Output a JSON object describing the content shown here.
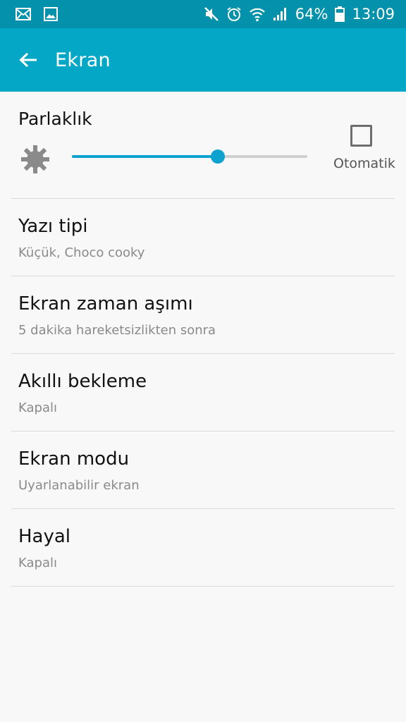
{
  "status_bar": {
    "battery": "64%",
    "time": "13:09",
    "icons": [
      "email-icon",
      "image-icon",
      "mute-icon",
      "alarm-icon",
      "wifi-icon",
      "signal-icon",
      "battery-icon"
    ]
  },
  "app_bar": {
    "title": "Ekran"
  },
  "brightness": {
    "title": "Parlaklık",
    "level_percent": 62,
    "auto_label": "Otomatik",
    "auto_checked": false
  },
  "settings": [
    {
      "title": "Yazı tipi",
      "subtitle": "Küçük, Choco cooky"
    },
    {
      "title": "Ekran zaman aşımı",
      "subtitle": "5 dakika hareketsizlikten sonra"
    },
    {
      "title": "Akıllı bekleme",
      "subtitle": "Kapalı"
    },
    {
      "title": "Ekran modu",
      "subtitle": "Uyarlanabilir ekran"
    },
    {
      "title": "Hayal",
      "subtitle": "Kapalı"
    }
  ],
  "colors": {
    "status_bar": "#0391ab",
    "app_bar": "#04a7c6",
    "accent": "#0ea3cf",
    "background": "#f8f8f8"
  }
}
